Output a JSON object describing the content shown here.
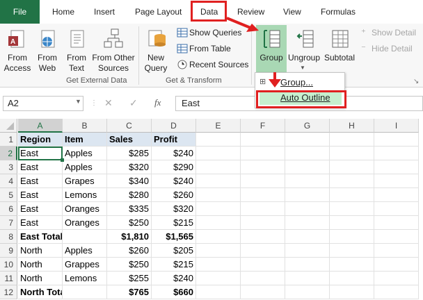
{
  "tabs": [
    {
      "label": "File"
    },
    {
      "label": "Home"
    },
    {
      "label": "Insert"
    },
    {
      "label": "Page Layout"
    },
    {
      "label": "Data"
    },
    {
      "label": "Review"
    },
    {
      "label": "View"
    },
    {
      "label": "Formulas"
    }
  ],
  "ribbon": {
    "get_external": {
      "from_access": "From\nAccess",
      "from_web": "From\nWeb",
      "from_text": "From\nText",
      "from_other": "From Other\nSources",
      "group_label": "Get External Data"
    },
    "get_transform": {
      "new_query": "New\nQuery",
      "show_queries": "Show Queries",
      "from_table": "From Table",
      "recent_sources": "Recent Sources",
      "group_label": "Get & Transform"
    },
    "outline": {
      "group": "Group",
      "ungroup": "Ungroup",
      "subtotal": "Subtotal",
      "show_detail": "Show Detail",
      "hide_detail": "Hide Detail"
    }
  },
  "group_menu": {
    "items": [
      {
        "label": "Group..."
      },
      {
        "label": "Auto Outline"
      }
    ]
  },
  "formula_bar": {
    "name_box": "A2",
    "fx": "fx",
    "content": "East"
  },
  "sheet": {
    "columns": [
      "A",
      "B",
      "C",
      "D",
      "E",
      "F",
      "G",
      "H",
      "I"
    ],
    "rows": [
      "1",
      "2",
      "3",
      "4",
      "5",
      "6",
      "7",
      "8",
      "9",
      "10",
      "11",
      "12"
    ],
    "data": [
      [
        "Region",
        "Item",
        "Sales",
        "Profit"
      ],
      [
        "East",
        "Apples",
        "$285",
        "$240"
      ],
      [
        "East",
        "Apples",
        "$320",
        "$290"
      ],
      [
        "East",
        "Grapes",
        "$340",
        "$240"
      ],
      [
        "East",
        "Lemons",
        "$280",
        "$260"
      ],
      [
        "East",
        "Oranges",
        "$335",
        "$320"
      ],
      [
        "East",
        "Oranges",
        "$250",
        "$215"
      ],
      [
        "East Total",
        "",
        "$1,810",
        "$1,565"
      ],
      [
        "North",
        "Apples",
        "$260",
        "$205"
      ],
      [
        "North",
        "Grappes",
        "$250",
        "$215"
      ],
      [
        "North",
        "Lemons",
        "$255",
        "$240"
      ],
      [
        "North Total",
        "",
        "$765",
        "$660"
      ]
    ]
  },
  "colors": {
    "excel_green": "#217346",
    "header_fill": "#dce6f1",
    "annotation_red": "#e02020",
    "group_highlight": "#a9d8b4",
    "auto_outline_highlight": "#c6efce"
  }
}
